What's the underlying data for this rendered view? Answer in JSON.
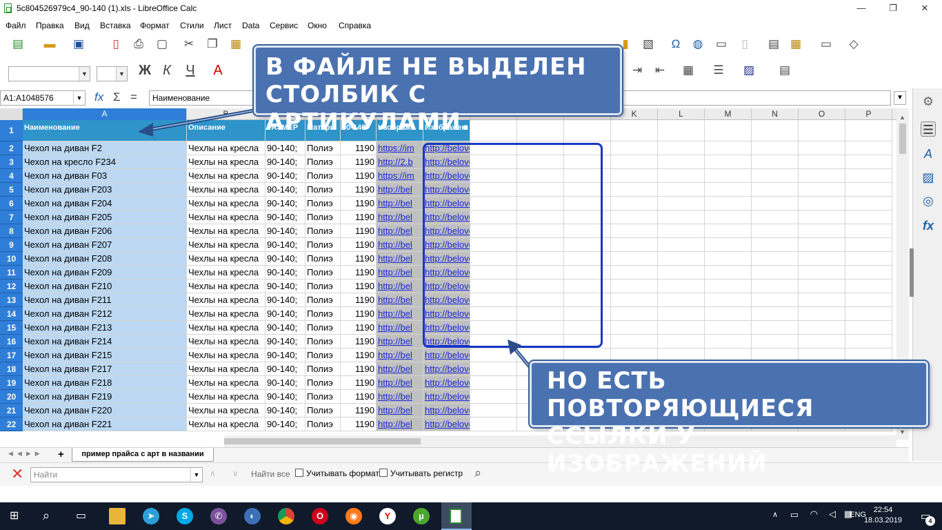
{
  "window": {
    "title": "5c804526979c4_90-140 (1).xls - LibreOffice Calc",
    "minimize": "—",
    "restore": "❐",
    "close": "✕"
  },
  "menu": [
    "Файл",
    "Правка",
    "Вид",
    "Вставка",
    "Формат",
    "Стили",
    "Лист",
    "Data",
    "Сервис",
    "Окно",
    "Справка"
  ],
  "formula_bar": {
    "name_box": "A1:A1048576",
    "formula": "Наименование",
    "fx": "fx",
    "sum": "Σ",
    "equals": "="
  },
  "columns": [
    "A",
    "B",
    "C",
    "D",
    "E",
    "F",
    "G",
    "H",
    "I",
    "J",
    "K",
    "L",
    "M",
    "N",
    "O",
    "P"
  ],
  "header_row": [
    "Наименование",
    "Описание",
    "РАЗМЕР",
    "Матери",
    "90-140",
    "Изображ",
    "Изображен"
  ],
  "rows": [
    {
      "n": "2",
      "name": "Чехол на диван F2",
      "desc": "Чехлы на кресла",
      "size": "90-140;",
      "mat": "Полиэ",
      "price": "1190",
      "img1": "https://im",
      "img2": "http://beloved-home.ru/img/case/AA.jpg"
    },
    {
      "n": "3",
      "name": "Чехол на кресло F234",
      "desc": "Чехлы на кресла",
      "size": "90-140;",
      "mat": "Полиэ",
      "price": "1190",
      "img1": "http://2.b",
      "img2": "http://beloved-home.ru/img/case/AA.jpg"
    },
    {
      "n": "4",
      "name": "Чехол на диван F03",
      "desc": "Чехлы на кресла",
      "size": "90-140;",
      "mat": "Полиэ",
      "price": "1190",
      "img1": "https://im",
      "img2": "http://beloved-home.ru/img/case/AA.jpg"
    },
    {
      "n": "5",
      "name": "Чехол на диван F203",
      "desc": "Чехлы на кресла",
      "size": "90-140;",
      "mat": "Полиэ",
      "price": "1190",
      "img1": "http://bel",
      "img2": "http://beloved-home.ru/img/case/AA.jpg"
    },
    {
      "n": "6",
      "name": "Чехол на диван F204",
      "desc": "Чехлы на кресла",
      "size": "90-140;",
      "mat": "Полиэ",
      "price": "1190",
      "img1": "http://bel",
      "img2": "http://beloved-home.ru/img/case/AA.jpg"
    },
    {
      "n": "7",
      "name": "Чехол на диван F205",
      "desc": "Чехлы на кресла",
      "size": "90-140;",
      "mat": "Полиэ",
      "price": "1190",
      "img1": "http://bel",
      "img2": "http://beloved-home.ru/img/case/AA.jpg"
    },
    {
      "n": "8",
      "name": "Чехол на диван F206",
      "desc": "Чехлы на кресла",
      "size": "90-140;",
      "mat": "Полиэ",
      "price": "1190",
      "img1": "http://bel",
      "img2": "http://beloved-home.ru/img/case/AA.jpg"
    },
    {
      "n": "9",
      "name": "Чехол на диван F207",
      "desc": "Чехлы на кресла",
      "size": "90-140;",
      "mat": "Полиэ",
      "price": "1190",
      "img1": "http://bel",
      "img2": "http://beloved-home.ru/img/case/AA.jpg"
    },
    {
      "n": "10",
      "name": "Чехол на диван F208",
      "desc": "Чехлы на кресла",
      "size": "90-140;",
      "mat": "Полиэ",
      "price": "1190",
      "img1": "http://bel",
      "img2": "http://beloved-home.ru/img/case/AA.jpg"
    },
    {
      "n": "11",
      "name": "Чехол на диван F209",
      "desc": "Чехлы на кресла",
      "size": "90-140;",
      "mat": "Полиэ",
      "price": "1190",
      "img1": "http://bel",
      "img2": "http://beloved-home.ru/img/case/AA.jpg"
    },
    {
      "n": "12",
      "name": "Чехол на диван F210",
      "desc": "Чехлы на кресла",
      "size": "90-140;",
      "mat": "Полиэ",
      "price": "1190",
      "img1": "http://bel",
      "img2": "http://beloved-home.ru/img/case/AA.jpg"
    },
    {
      "n": "13",
      "name": "Чехол на диван F211",
      "desc": "Чехлы на кресла",
      "size": "90-140;",
      "mat": "Полиэ",
      "price": "1190",
      "img1": "http://bel",
      "img2": "http://beloved-home.ru/img/case/AA.jpg"
    },
    {
      "n": "14",
      "name": "Чехол на диван F212",
      "desc": "Чехлы на кресла",
      "size": "90-140;",
      "mat": "Полиэ",
      "price": "1190",
      "img1": "http://bel",
      "img2": "http://beloved-home.ru/img/case/AA.jpg"
    },
    {
      "n": "15",
      "name": "Чехол на диван F213",
      "desc": "Чехлы на кресла",
      "size": "90-140;",
      "mat": "Полиэ",
      "price": "1190",
      "img1": "http://bel",
      "img2": "http://beloved-home.ru/img/case/AA.jpg"
    },
    {
      "n": "16",
      "name": "Чехол на диван F214",
      "desc": "Чехлы на кресла",
      "size": "90-140;",
      "mat": "Полиэ",
      "price": "1190",
      "img1": "http://bel",
      "img2": "http://beloved-home.ru/img/case/AA.jpg"
    },
    {
      "n": "17",
      "name": "Чехол на диван F215",
      "desc": "Чехлы на кресла",
      "size": "90-140;",
      "mat": "Полиэ",
      "price": "1190",
      "img1": "http://bel",
      "img2": "http://beloved-home.ru/img/case/AA.jpg"
    },
    {
      "n": "18",
      "name": "Чехол на диван F217",
      "desc": "Чехлы на кресла",
      "size": "90-140;",
      "mat": "Полиэ",
      "price": "1190",
      "img1": "http://bel",
      "img2": "http://beloved-home.ru/img/case/AA.jpg"
    },
    {
      "n": "19",
      "name": "Чехол на диван F218",
      "desc": "Чехлы на кресла",
      "size": "90-140;",
      "mat": "Полиэ",
      "price": "1190",
      "img1": "http://bel",
      "img2": "http://beloved-home.ru/img/case/AA.jpg"
    },
    {
      "n": "20",
      "name": "Чехол на диван F219",
      "desc": "Чехлы на кресла",
      "size": "90-140;",
      "mat": "Полиэ",
      "price": "1190",
      "img1": "http://bel",
      "img2": "http://beloved-home.ru/img/case/AA.jpg"
    },
    {
      "n": "21",
      "name": "Чехол на диван F220",
      "desc": "Чехлы на кресла",
      "size": "90-140;",
      "mat": "Полиэ",
      "price": "1190",
      "img1": "http://bel",
      "img2": "http://beloved-home.ru/img/case/AA.jpg"
    },
    {
      "n": "22",
      "name": "Чехол на диван F221",
      "desc": "Чехлы на кресла",
      "size": "90-140;",
      "mat": "Полиэ",
      "price": "1190",
      "img1": "http://bel",
      "img2": "http://beloved-home.ru/img/case/AA.jpg"
    }
  ],
  "sheet_tab": "пример прайса с арт в названии",
  "find_bar": {
    "placeholder": "Найти",
    "find_all": "Найти все",
    "match_format": "Учитывать формат",
    "match_case": "Учитывать регистр"
  },
  "callouts": {
    "top": [
      "В ФАЙЛЕ НЕ ВЫДЕЛЕН",
      "СТОЛБИК С АРТИКУЛАМИ."
    ],
    "bottom": [
      "НО ЕСТЬ ПОВТОРЯЮЩИЕСЯ",
      "ССЫЛКИ У ИЗОБРАЖЕНИЙ"
    ]
  },
  "taskbar": {
    "time": "22:54",
    "date": "18.03.2019",
    "lang": "ENG",
    "notifications": "4"
  },
  "colors": {
    "selection": "#2f7ed8",
    "header_fill": "#2e94c9",
    "callout": "#4b72b0",
    "frame": "#1537c7"
  }
}
